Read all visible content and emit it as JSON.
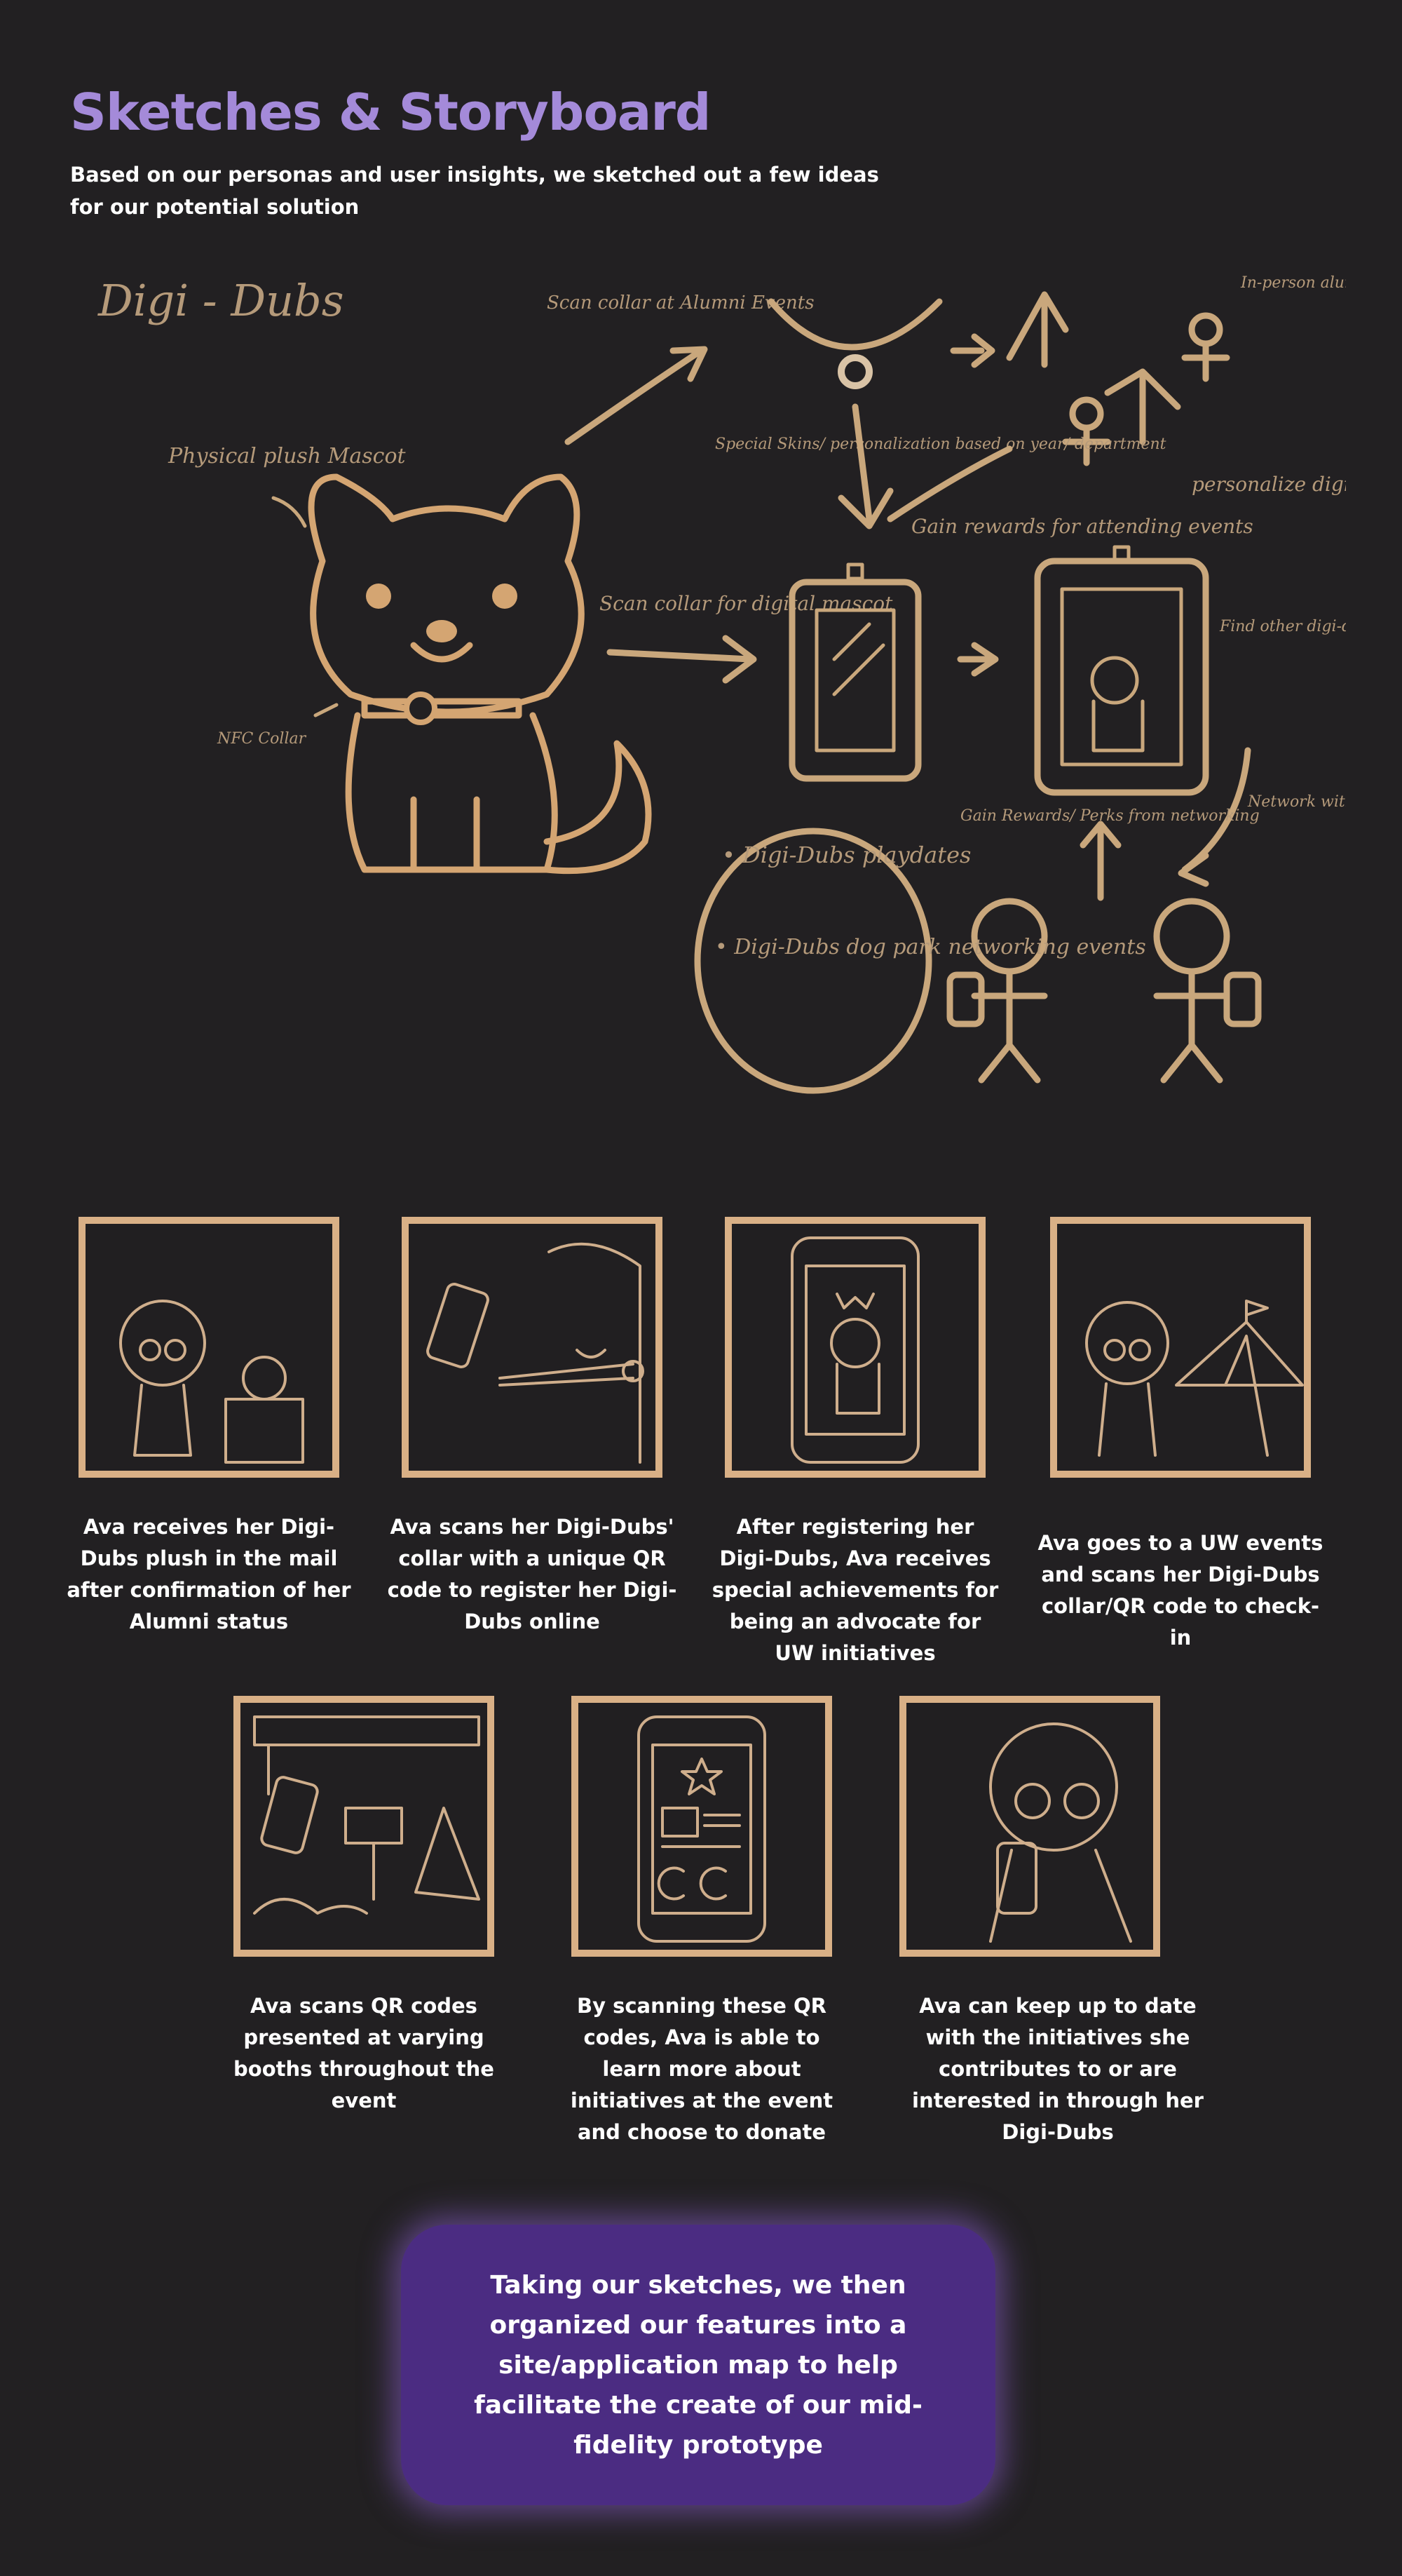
{
  "header": {
    "title": "Sketches & Storyboard",
    "intro": "Based on our personas and user insights, we sketched out a few ideas for our potential solution"
  },
  "sketch": {
    "brand": "Digi - Dubs",
    "notes": {
      "physical_plush": "Physical plush Mascot",
      "nfc_collar": "NFC Collar",
      "scan_alumni": "Scan collar at Alumni Events",
      "in_person": "In-person alumni events",
      "special_skins": "Special Skins/ personalization based on year/ department",
      "gain_rewards": "Gain rewards for attending events",
      "personalize": "personalize digi-dubs",
      "scan_digital": "Scan collar for digital mascot",
      "find_other": "Find other digi-dubs with similar interests",
      "network": "Network with digi-dubs",
      "gain_perks": "Gain Rewards/ Perks from networking",
      "playdates": "• Digi-Dubs playdates",
      "dog_park": "• Digi-Dubs dog park networking events"
    }
  },
  "storyboard": [
    {
      "caption": "Ava receives her Digi-Dubs plush in the mail after confirmation of her Alumni status",
      "icon": "plush-box-icon"
    },
    {
      "caption": "Ava scans her Digi-Dubs' collar with a unique QR code to register her Digi-Dubs online",
      "icon": "phone-scan-collar-icon"
    },
    {
      "caption": "After registering her Digi-Dubs, Ava receives special achievements for being an advocate for UW initiatives",
      "icon": "phone-mascot-icon"
    },
    {
      "caption": "Ava goes to a UW events and scans her Digi-Dubs collar/QR code to check-in",
      "icon": "event-tent-icon"
    },
    {
      "caption": "Ava scans QR codes presented at varying booths throughout the event",
      "icon": "booth-qr-icon"
    },
    {
      "caption": "By scanning these QR codes, Ava is able to learn more about initiatives at the event and choose to donate",
      "icon": "phone-initiative-icon"
    },
    {
      "caption": "Ava can keep up to date with the initiatives she contributes to or are interested in through her Digi-Dubs",
      "icon": "ava-phone-icon"
    }
  ],
  "callout": {
    "text": "Taking our sketches, we then organized our features into a site/application map to help facilitate the create of our mid-fidelity prototype"
  },
  "colors": {
    "background": "#222022",
    "title": "#a48ad9",
    "sketch": "#c9a77c",
    "callout": "#4b2c82"
  }
}
